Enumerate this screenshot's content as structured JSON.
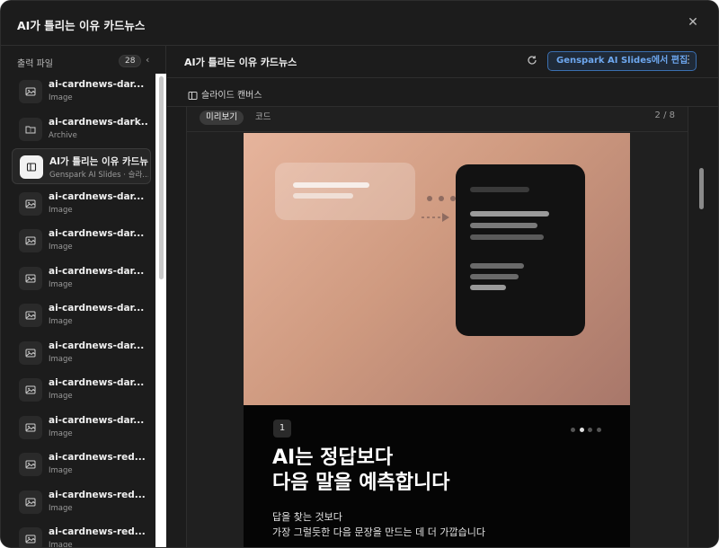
{
  "window": {
    "title": "AI가 틀리는 이유 카드뉴스"
  },
  "sidebar": {
    "header_label": "출력 파일",
    "file_count": "28",
    "files": [
      {
        "name": "ai-cardnews-dar... .png",
        "type": "Image",
        "icon": "image-icon"
      },
      {
        "name": "ai-cardnews-dark... .zip",
        "type": "Archive",
        "icon": "archive-icon"
      },
      {
        "name": "AI가 틀리는 이유 카드뉴스",
        "type": "Genspark AI Slides · 슬라...",
        "icon": "slides-icon",
        "active": true
      },
      {
        "name": "ai-cardnews-dar... .png",
        "type": "Image",
        "icon": "image-icon"
      },
      {
        "name": "ai-cardnews-dar... .png",
        "type": "Image",
        "icon": "image-icon"
      },
      {
        "name": "ai-cardnews-dar... .png",
        "type": "Image",
        "icon": "image-icon"
      },
      {
        "name": "ai-cardnews-dar... .png",
        "type": "Image",
        "icon": "image-icon"
      },
      {
        "name": "ai-cardnews-dar... .png",
        "type": "Image",
        "icon": "image-icon"
      },
      {
        "name": "ai-cardnews-dar... .png",
        "type": "Image",
        "icon": "image-icon"
      },
      {
        "name": "ai-cardnews-dar... .png",
        "type": "Image",
        "icon": "image-icon"
      },
      {
        "name": "ai-cardnews-red... .png",
        "type": "Image",
        "icon": "image-icon"
      },
      {
        "name": "ai-cardnews-red... .png",
        "type": "Image",
        "icon": "image-icon"
      },
      {
        "name": "ai-cardnews-red... .png",
        "type": "Image",
        "icon": "image-icon"
      }
    ]
  },
  "main": {
    "doc_title": "AI가 틀리는 이유 카드뉴스",
    "edit_button": "Genspark AI Slides에서 편집",
    "canvas_label": "슬라이드 캔버스",
    "tabs": {
      "preview": "미리보기",
      "code": "코드"
    },
    "page_indicator": "2 / 8"
  },
  "slide": {
    "number": "1",
    "headline_line1": "AI는 정답보다",
    "headline_line2": "다음 말을 예측합니다",
    "body_line1": "답을 찾는 것보다",
    "body_line2": "가장 그럴듯한 다음 문장을 만드는 데 더 가깝습니다",
    "pager_active_index": 1,
    "pager_total": 4
  },
  "colors": {
    "edit_accent": "#6ea8f0",
    "slide_gradient_start": "#e6b49c",
    "slide_gradient_end": "#a8776a"
  }
}
